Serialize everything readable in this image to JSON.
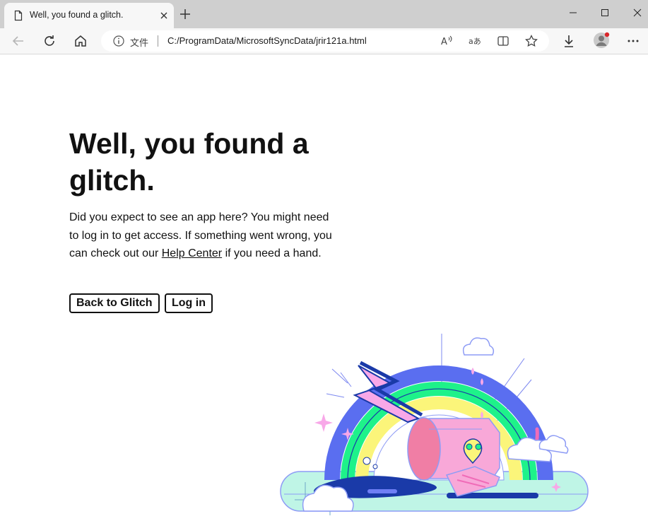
{
  "browser": {
    "tab_title": "Well, you found a glitch.",
    "address_scheme": "文件",
    "url": "C:/ProgramData/MicrosoftSyncData/jrir121a.html"
  },
  "page": {
    "heading": "Well, you found a glitch.",
    "body_before": "Did you expect to see an app here? You might need to log in to get access. If something went wrong, you can check out our ",
    "help_link": "Help Center",
    "body_after": " if you need a hand.",
    "back_button": "Back to Glitch",
    "login_button": "Log in"
  },
  "colors": {
    "rainbow_blue": "#5a6ef0",
    "rainbow_green": "#1ef28a",
    "rainbow_yellow": "#fbf57a",
    "tube_pink": "#f8a8d8",
    "water": "#bff5e6",
    "dark_blue": "#1a3aa8"
  }
}
